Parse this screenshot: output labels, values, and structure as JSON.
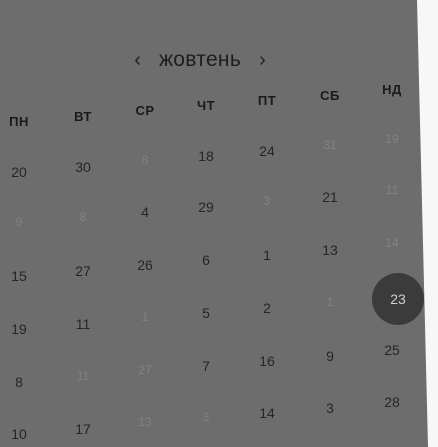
{
  "calendar": {
    "month": "жовтень",
    "prev_icon": "‹",
    "next_icon": "›",
    "weekdays": [
      "ПН",
      "ВТ",
      "СР",
      "ЧТ",
      "ПТ",
      "СБ",
      "НД"
    ],
    "weeks": [
      [
        {
          "t": "20"
        },
        {
          "t": "30"
        },
        {
          "t": "8",
          "m": 1
        },
        {
          "t": "18"
        },
        {
          "t": "24"
        },
        {
          "t": "31",
          "m": 1
        },
        {
          "t": "19",
          "m": 1
        }
      ],
      [
        {
          "t": "9",
          "m": 1
        },
        {
          "t": "8",
          "m": 1
        },
        {
          "t": "4"
        },
        {
          "t": "29"
        },
        {
          "t": "3",
          "m": 1
        },
        {
          "t": "21"
        },
        {
          "t": "11",
          "m": 1
        }
      ],
      [
        {
          "t": "15"
        },
        {
          "t": "27"
        },
        {
          "t": "26"
        },
        {
          "t": "6"
        },
        {
          "t": "1"
        },
        {
          "t": "13"
        },
        {
          "t": "14",
          "m": 1
        }
      ],
      [
        {
          "t": "19"
        },
        {
          "t": "11"
        },
        {
          "t": "1",
          "m": 1
        },
        {
          "t": "5"
        },
        {
          "t": "2"
        },
        {
          "t": "1",
          "m": 1
        },
        {
          "t": "23",
          "sel": 1
        }
      ],
      [
        {
          "t": "8"
        },
        {
          "t": "11",
          "m": 1
        },
        {
          "t": "27",
          "m": 1
        },
        {
          "t": "7"
        },
        {
          "t": "16"
        },
        {
          "t": "9"
        },
        {
          "t": "25"
        }
      ],
      [
        {
          "t": "10"
        },
        {
          "t": "17"
        },
        {
          "t": "13",
          "m": 1
        },
        {
          "t": "3",
          "m": 1
        },
        {
          "t": "14"
        },
        {
          "t": "3"
        },
        {
          "t": "28"
        }
      ]
    ]
  }
}
